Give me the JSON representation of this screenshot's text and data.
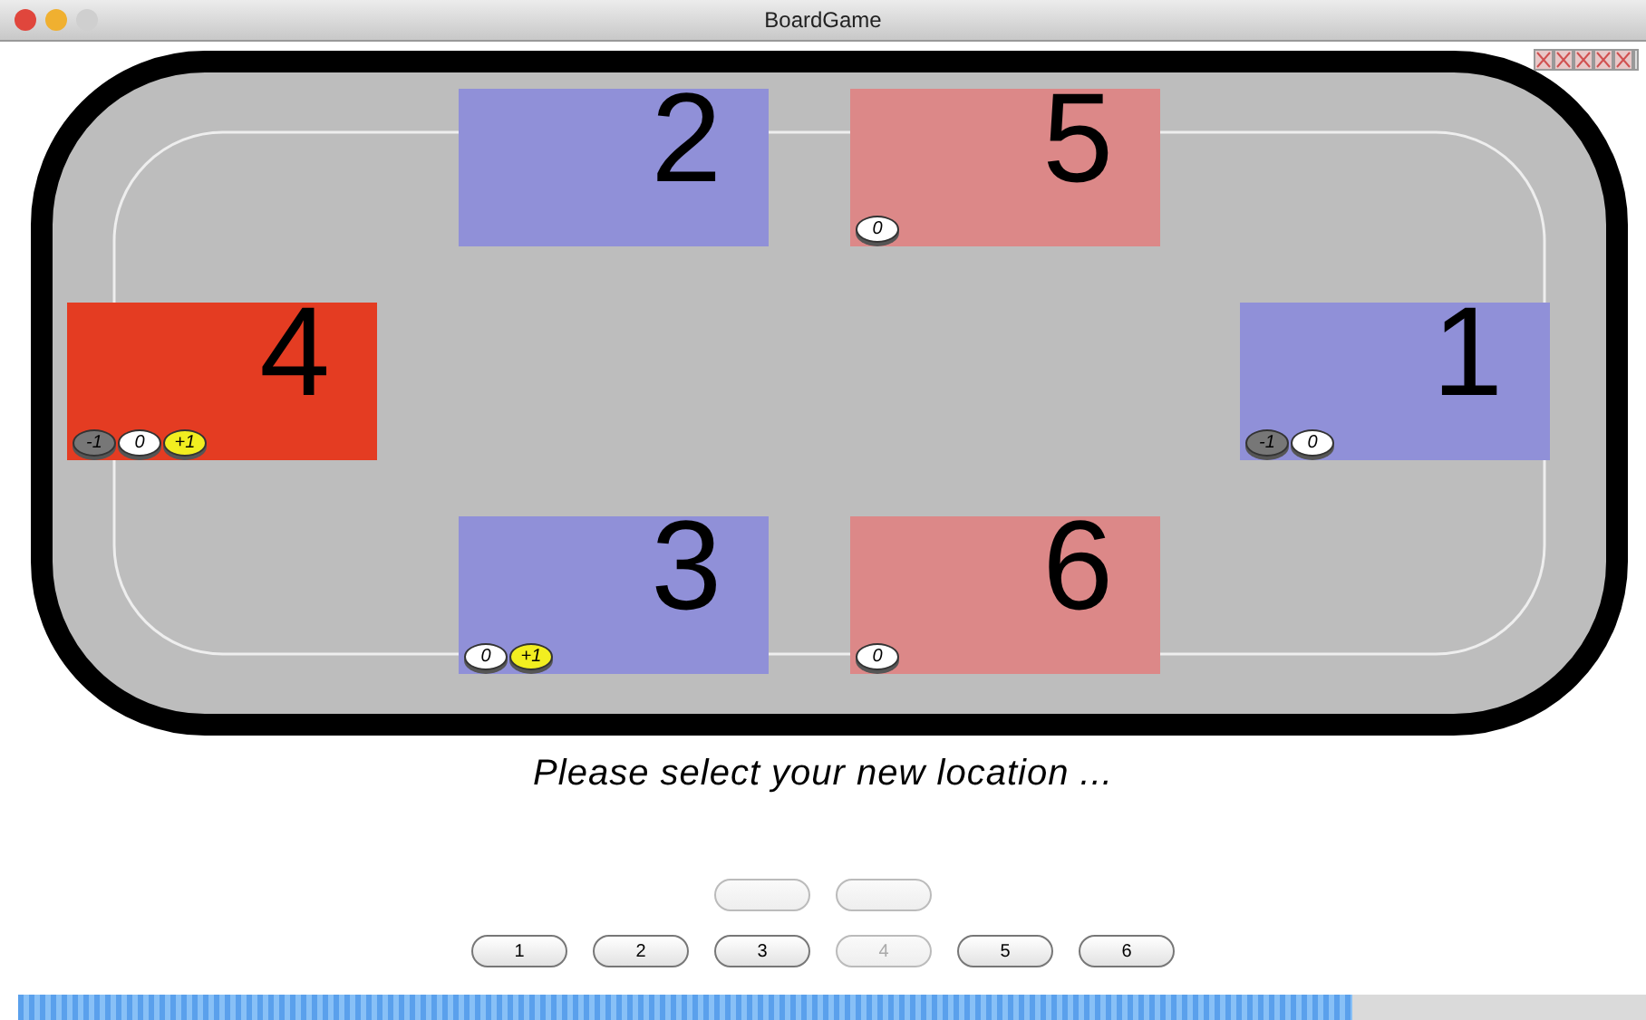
{
  "window": {
    "title": "BoardGame"
  },
  "zones": [
    {
      "number": "2",
      "color": "#9090d8"
    },
    {
      "number": "5",
      "color": "#dc8888",
      "tokens": [
        {
          "kind": "zero",
          "label": "0"
        }
      ]
    },
    {
      "number": "4",
      "color": "#e43c22",
      "tokens": [
        {
          "kind": "minus",
          "label": "-1"
        },
        {
          "kind": "zero",
          "label": "0"
        },
        {
          "kind": "plus",
          "label": "+1"
        }
      ]
    },
    {
      "number": "1",
      "color": "#9090d8",
      "tokens": [
        {
          "kind": "minus",
          "label": "-1"
        },
        {
          "kind": "zero",
          "label": "0"
        }
      ]
    },
    {
      "number": "3",
      "color": "#9090d8",
      "tokens": [
        {
          "kind": "zero",
          "label": "0"
        },
        {
          "kind": "plus",
          "label": "+1"
        }
      ]
    },
    {
      "number": "6",
      "color": "#dc8888",
      "tokens": [
        {
          "kind": "zero",
          "label": "0"
        }
      ]
    }
  ],
  "message": "Please select your new location ...",
  "blank_buttons": [
    {
      "disabled": true
    },
    {
      "disabled": true
    }
  ],
  "buttons": [
    {
      "label": "1",
      "disabled": false
    },
    {
      "label": "2",
      "disabled": false
    },
    {
      "label": "3",
      "disabled": false
    },
    {
      "label": "4",
      "disabled": true
    },
    {
      "label": "5",
      "disabled": false
    },
    {
      "label": "6",
      "disabled": false
    }
  ],
  "progress": {
    "level": 0.82
  }
}
